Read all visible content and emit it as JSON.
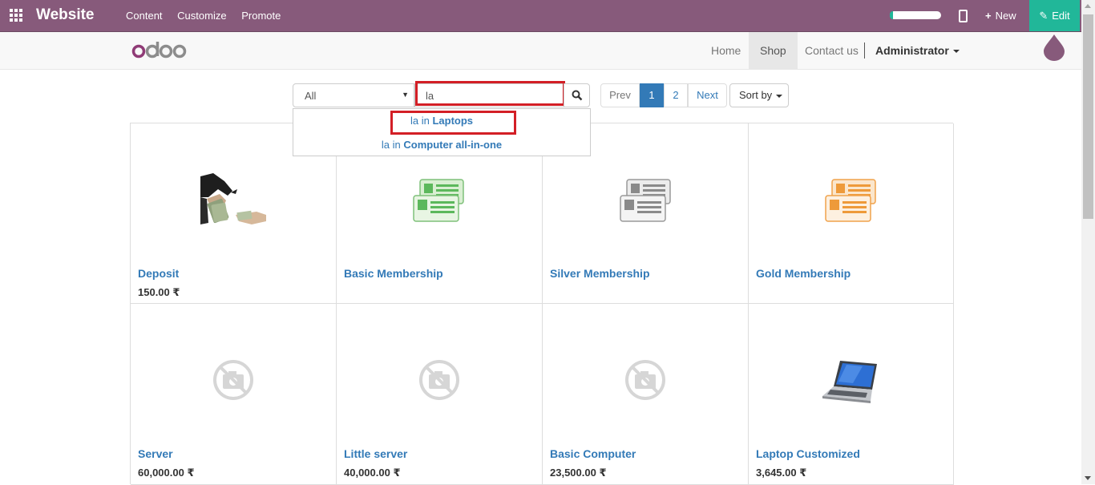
{
  "topbar": {
    "brand": "Website",
    "menu": [
      "Content",
      "Customize",
      "Promote"
    ],
    "new_label": "New",
    "edit_label": "Edit",
    "accent": "#875a7b",
    "edit_color": "#21b799"
  },
  "navbar": {
    "logo_text": "odoo",
    "items": [
      "Home",
      "Shop",
      "Contact us"
    ],
    "active": "Shop",
    "user": "Administrator"
  },
  "search": {
    "category": "All",
    "query": "la",
    "suggestions": [
      {
        "term": "la",
        "sep": "in",
        "category": "Laptops"
      },
      {
        "term": "la",
        "sep": "in",
        "category": "Computer all-in-one"
      }
    ]
  },
  "pager": {
    "prev": "Prev",
    "pages": [
      "1",
      "2"
    ],
    "current": "1",
    "next": "Next"
  },
  "sort_label": "Sort by",
  "products": [
    {
      "name": "Deposit",
      "price": "150.00 ₹",
      "icon": "money-hands-icon"
    },
    {
      "name": "Basic Membership",
      "price": "",
      "icon": "membership-card-green-icon"
    },
    {
      "name": "Silver Membership",
      "price": "",
      "icon": "membership-card-grey-icon"
    },
    {
      "name": "Gold Membership",
      "price": "",
      "icon": "membership-card-orange-icon"
    },
    {
      "name": "Server",
      "price": "60,000.00 ₹",
      "icon": "no-image-icon"
    },
    {
      "name": "Little server",
      "price": "40,000.00 ₹",
      "icon": "no-image-icon"
    },
    {
      "name": "Basic Computer",
      "price": "23,500.00 ₹",
      "icon": "no-image-icon"
    },
    {
      "name": "Laptop Customized",
      "price": "3,645.00 ₹",
      "icon": "laptop-icon"
    }
  ],
  "highlight_color": "#d31f26"
}
